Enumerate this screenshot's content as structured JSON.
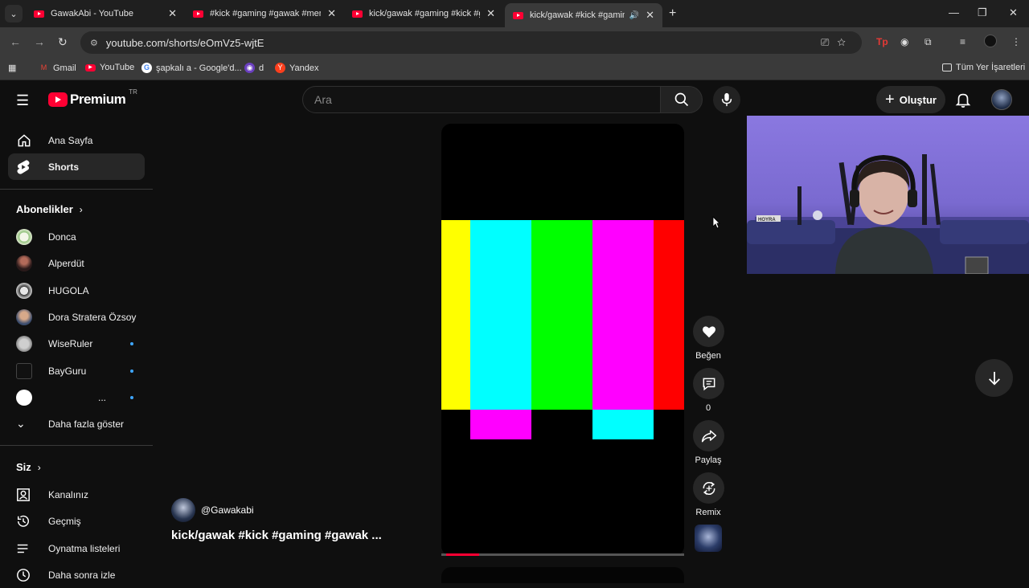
{
  "browser": {
    "tabs": [
      {
        "title": "GawakAbi - YouTube"
      },
      {
        "title": "#kick #gaming #gawak #meme"
      },
      {
        "title": "kick/gawak #gaming #kick #ga"
      },
      {
        "title": "kick/gawak #kick #gaming"
      }
    ],
    "url": "youtube.com/shorts/eOmVz5-wjtE",
    "bookmarks": [
      "Gmail",
      "YouTube",
      "şapkalı a - Google'd...",
      "d",
      "Yandex"
    ],
    "all_bookmarks": "Tüm Yer İşaretleri"
  },
  "youtube": {
    "logo": "Premium",
    "region": "TR",
    "search_placeholder": "Ara",
    "create_label": "Oluştur"
  },
  "sidebar": {
    "home": "Ana Sayfa",
    "shorts": "Shorts",
    "subscriptions_header": "Abonelikler",
    "channels": [
      {
        "name": "Donca",
        "new": false
      },
      {
        "name": "Alperdüt",
        "new": false
      },
      {
        "name": "HUGOLA",
        "new": false
      },
      {
        "name": "Dora Stratera Özsoy",
        "new": false
      },
      {
        "name": "WiseRuler",
        "new": true
      },
      {
        "name": "BayGuru",
        "new": true
      },
      {
        "name": "...",
        "new": true
      }
    ],
    "show_more": "Daha fazla göster",
    "you_header": "Siz",
    "you_items": [
      "Kanalınız",
      "Geçmiş",
      "Oynatma listeleri",
      "Daha sonra izle"
    ]
  },
  "short": {
    "channel": "@Gawakabi",
    "title": "kick/gawak #kick #gaming #gawak ...",
    "like_label": "Beğen",
    "comment_count": "0",
    "share_label": "Paylaş",
    "remix_label": "Remix",
    "progress": 0.14,
    "colors": {
      "bars": [
        "#ffff00",
        "#00ffff",
        "#00ff00",
        "#ff00ff",
        "#ff0000"
      ],
      "lower_bars": [
        "#ff00ff",
        "#00ffff"
      ]
    }
  },
  "webcam": {
    "sign": "HOYRA"
  }
}
